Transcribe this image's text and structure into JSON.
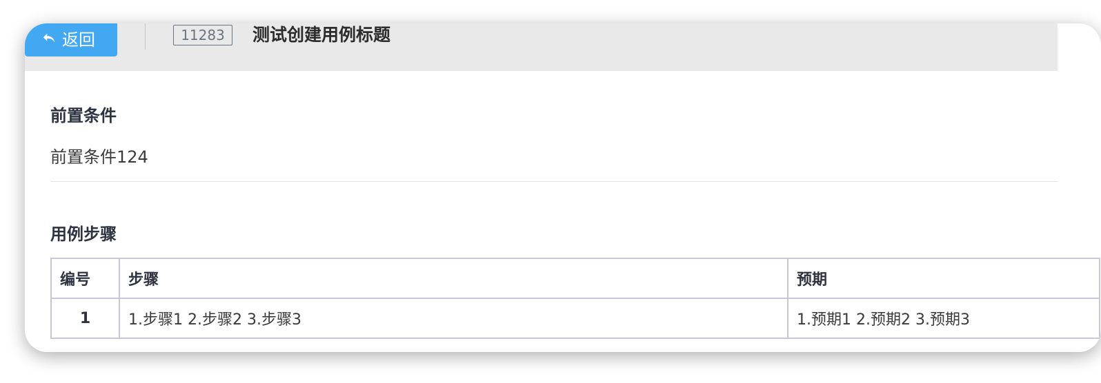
{
  "header": {
    "back_label": "返回",
    "case_id": "11283",
    "case_title": "测试创建用例标题"
  },
  "precondition": {
    "title": "前置条件",
    "text": "前置条件124"
  },
  "steps": {
    "title": "用例步骤",
    "columns": [
      "编号",
      "步骤",
      "预期"
    ],
    "rows": [
      {
        "num": "1",
        "step": "1.步骤1 2.步骤2 3.步骤3",
        "expected": "1.预期1 2.预期2 3.预期3"
      }
    ]
  },
  "colors": {
    "accent": "#42a8f1",
    "header_bg": "#e9e9e9",
    "table_border": "#c7c7d9"
  }
}
